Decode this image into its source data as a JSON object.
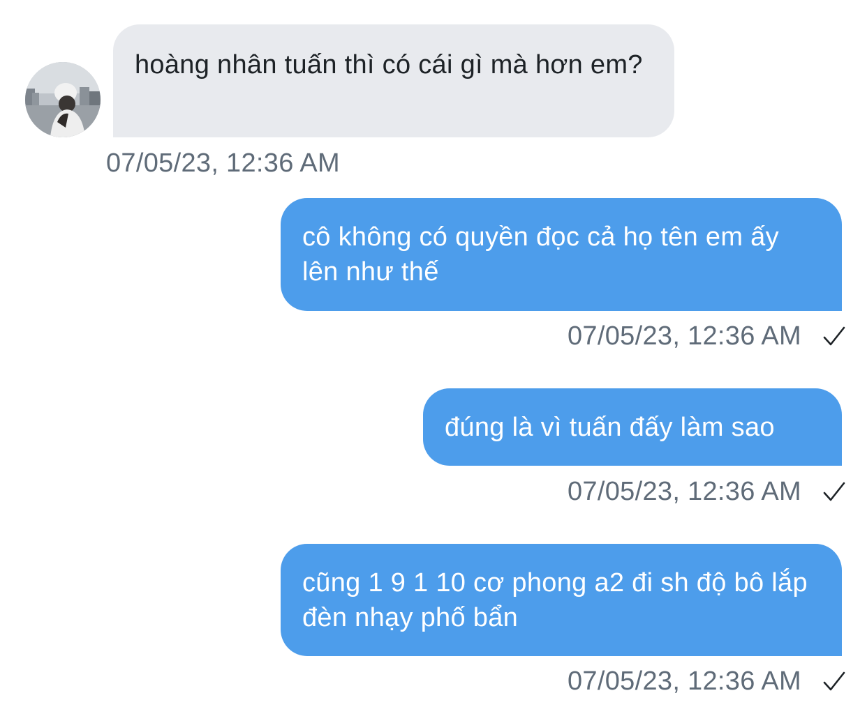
{
  "conversation": {
    "messages": [
      {
        "direction": "received",
        "text": "hoàng nhân tuấn thì có cái gì mà hơn em?",
        "timestamp": "07/05/23, 12:36 AM"
      },
      {
        "direction": "sent",
        "text": "cô không có quyền đọc cả họ tên em ấy lên như thế",
        "timestamp": "07/05/23, 12:36 AM",
        "status_icon": "check-icon"
      },
      {
        "direction": "sent",
        "text": "đúng là vì tuấn đấy làm sao",
        "timestamp": "07/05/23, 12:36 AM",
        "status_icon": "check-icon"
      },
      {
        "direction": "sent",
        "text": "cũng 1 9 1 10 cơ phong a2 đi sh độ bô lắp đèn nhạy phố bẩn",
        "timestamp": "07/05/23, 12:36 AM",
        "status_icon": "check-icon"
      }
    ]
  },
  "colors": {
    "sent_bubble": "#4d9deb",
    "received_bubble": "#e8eaee",
    "timestamp": "#5f6b78"
  }
}
